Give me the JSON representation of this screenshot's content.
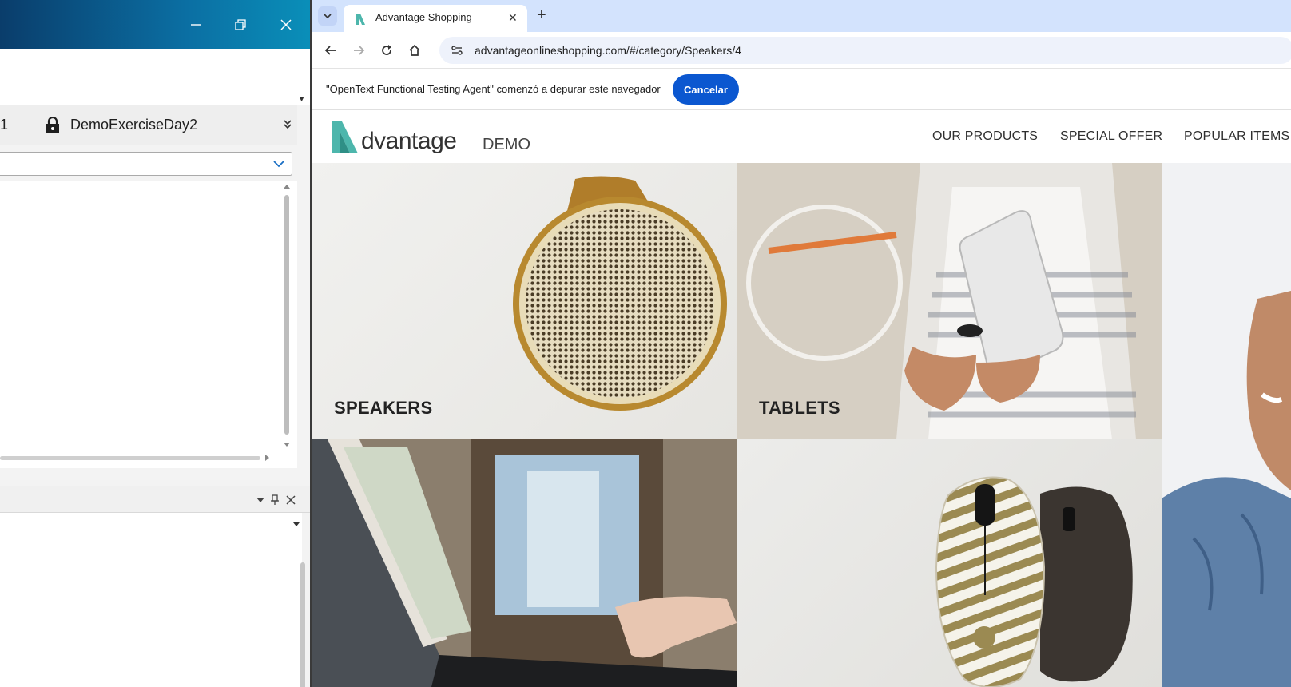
{
  "ide": {
    "tab_partial": "1",
    "tab_title": "DemoExerciseDay2"
  },
  "browser": {
    "tab": {
      "title": "Advantage Shopping"
    },
    "url": "advantageonlineshopping.com/#/category/Speakers/4",
    "infobar": {
      "message": "\"OpenText Functional Testing Agent\" comenzó a depurar este navegador",
      "button_label": "Cancelar"
    },
    "accent_color": "#0b57d0",
    "tabstrip_color": "#d3e3fd"
  },
  "site": {
    "logo_text": "dvantage",
    "logo_suffix": "DEMO",
    "logo_color": "#4db6ac",
    "nav": {
      "our_products": "OUR PRODUCTS",
      "special_offer": "SPECIAL OFFER",
      "popular_items": "POPULAR ITEMS"
    },
    "tiles": {
      "speakers": "SPEAKERS",
      "tablets": "TABLETS"
    }
  }
}
